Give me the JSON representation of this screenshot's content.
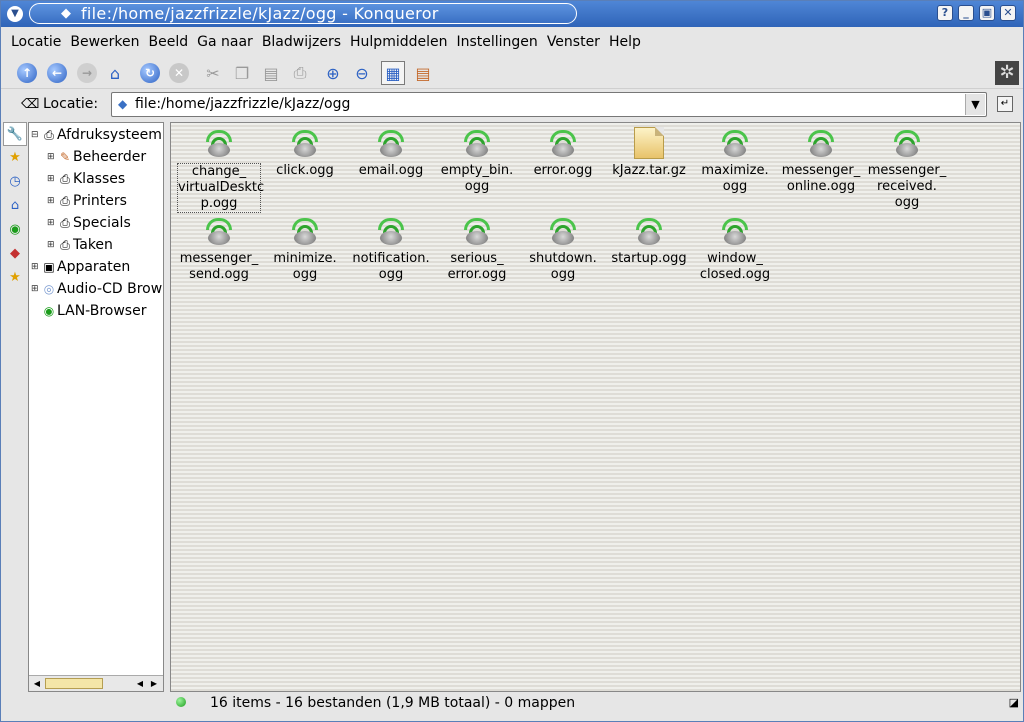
{
  "window": {
    "title": "file:/home/jazzfrizzle/kJazz/ogg - Konqueror",
    "buttons": [
      "?",
      "_",
      "▣",
      "✕"
    ]
  },
  "menubar": [
    "Locatie",
    "Bewerken",
    "Beeld",
    "Ga naar",
    "Bladwijzers",
    "Hulpmiddelen",
    "Instellingen",
    "Venster",
    "Help"
  ],
  "location": {
    "label": "Locatie:",
    "value": "file:/home/jazzfrizzle/kJazz/ogg"
  },
  "tree": [
    {
      "label": "Afdruksysteem",
      "expanded": true,
      "icon": "printer-icon"
    },
    {
      "label": "Beheerder",
      "icon": "wand-icon"
    },
    {
      "label": "Klasses",
      "icon": "printer-icon"
    },
    {
      "label": "Printers",
      "icon": "printer-icon"
    },
    {
      "label": "Specials",
      "icon": "printer-icon"
    },
    {
      "label": "Taken",
      "icon": "printer-icon"
    },
    {
      "label": "Apparaten",
      "icon": "devices-icon"
    },
    {
      "label": "Audio-CD Brow",
      "icon": "cd-icon"
    },
    {
      "label": "LAN-Browser",
      "icon": "network-icon"
    }
  ],
  "files": [
    {
      "name": "change_\nvirtualDesktop.ogg",
      "l1": "change_",
      "l2": "virtualDesktc",
      "l3": "p.ogg",
      "type": "sound"
    },
    {
      "name": "click.ogg",
      "l1": "click.ogg",
      "type": "sound"
    },
    {
      "name": "email.ogg",
      "l1": "email.ogg",
      "type": "sound"
    },
    {
      "name": "empty_bin.ogg",
      "l1": "empty_bin.",
      "l2": "ogg",
      "type": "sound"
    },
    {
      "name": "error.ogg",
      "l1": "error.ogg",
      "type": "sound"
    },
    {
      "name": "kJazz.tar.gz",
      "l1": "kJazz.tar.gz",
      "type": "archive"
    },
    {
      "name": "maximize.ogg",
      "l1": "maximize.",
      "l2": "ogg",
      "type": "sound"
    },
    {
      "name": "messenger_online.ogg",
      "l1": "messenger_",
      "l2": "online.ogg",
      "type": "sound"
    },
    {
      "name": "messenger_received.ogg",
      "l1": "messenger_",
      "l2": "received.",
      "l3": "ogg",
      "type": "sound"
    },
    {
      "name": "messenger_send.ogg",
      "l1": "messenger_",
      "l2": "send.ogg",
      "type": "sound"
    },
    {
      "name": "minimize.ogg",
      "l1": "minimize.",
      "l2": "ogg",
      "type": "sound"
    },
    {
      "name": "notification.ogg",
      "l1": "notification.",
      "l2": "ogg",
      "type": "sound"
    },
    {
      "name": "serious_error.ogg",
      "l1": "serious_",
      "l2": "error.ogg",
      "type": "sound"
    },
    {
      "name": "shutdown.ogg",
      "l1": "shutdown.",
      "l2": "ogg",
      "type": "sound"
    },
    {
      "name": "startup.ogg",
      "l1": "startup.ogg",
      "type": "sound"
    },
    {
      "name": "window_closed.ogg",
      "l1": "window_",
      "l2": "closed.ogg",
      "type": "sound"
    }
  ],
  "status": {
    "text": "16 items - 16 bestanden (1,9 MB totaal) - 0 mappen"
  }
}
